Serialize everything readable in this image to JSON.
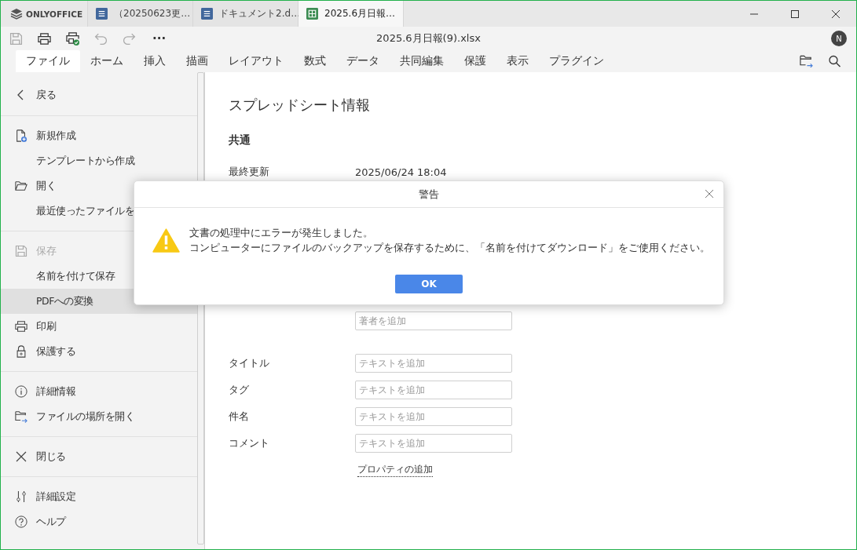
{
  "app": {
    "name": "ONLYOFFICE"
  },
  "tabs": [
    {
      "label": "（20250623更…",
      "kind": "document",
      "selected": false
    },
    {
      "label": "ドキュメント2.d…",
      "kind": "document",
      "selected": false
    },
    {
      "label": "2025.6月日報…",
      "kind": "spreadsheet",
      "selected": true
    }
  ],
  "toolbar": {
    "title": "2025.6月日報(9).xlsx",
    "avatar": "N",
    "more": "···"
  },
  "menu": [
    {
      "label": "ファイル",
      "selected": true
    },
    {
      "label": "ホーム",
      "selected": false
    },
    {
      "label": "挿入",
      "selected": false
    },
    {
      "label": "描画",
      "selected": false
    },
    {
      "label": "レイアウト",
      "selected": false
    },
    {
      "label": "数式",
      "selected": false
    },
    {
      "label": "データ",
      "selected": false
    },
    {
      "label": "共同編集",
      "selected": false
    },
    {
      "label": "保護",
      "selected": false
    },
    {
      "label": "表示",
      "selected": false
    },
    {
      "label": "プラグイン",
      "selected": false
    }
  ],
  "sidebar": {
    "groups": [
      [
        {
          "label": "戻る",
          "kind": "back",
          "selected": false,
          "disabled": false
        }
      ],
      [
        {
          "label": "新規作成",
          "kind": "new",
          "selected": false,
          "disabled": false
        },
        {
          "label": "テンプレートから作成",
          "kind": "plain",
          "selected": false,
          "disabled": false
        },
        {
          "label": "開く",
          "kind": "open",
          "selected": false,
          "disabled": false
        },
        {
          "label": "最近使ったファイルを",
          "kind": "plain",
          "selected": false,
          "disabled": false
        }
      ],
      [
        {
          "label": "保存",
          "kind": "save",
          "selected": false,
          "disabled": true
        },
        {
          "label": "名前を付けて保存",
          "kind": "plain",
          "selected": false,
          "disabled": false
        },
        {
          "label": "PDFへの変換",
          "kind": "plain",
          "selected": true,
          "disabled": false
        },
        {
          "label": "印刷",
          "kind": "print",
          "selected": false,
          "disabled": false
        },
        {
          "label": "保護する",
          "kind": "lock",
          "selected": false,
          "disabled": false
        }
      ],
      [
        {
          "label": "詳細情報",
          "kind": "info",
          "selected": false,
          "disabled": false
        },
        {
          "label": "ファイルの場所を開く",
          "kind": "location",
          "selected": false,
          "disabled": false
        }
      ],
      [
        {
          "label": "閉じる",
          "kind": "close",
          "selected": false,
          "disabled": false
        }
      ],
      [
        {
          "label": "詳細設定",
          "kind": "settings",
          "selected": false,
          "disabled": false
        },
        {
          "label": "ヘルプ",
          "kind": "help",
          "selected": false,
          "disabled": false
        }
      ]
    ]
  },
  "info": {
    "title": "スプレッドシート情報",
    "section": "共通",
    "last_modified": {
      "label": "最終更新",
      "value": "2025/06/24 18:04"
    },
    "author_field": {
      "placeholder": "著者を追加"
    },
    "properties": [
      {
        "label": "タイトル",
        "placeholder": "テキストを追加"
      },
      {
        "label": "タグ",
        "placeholder": "テキストを追加"
      },
      {
        "label": "件名",
        "placeholder": "テキストを追加"
      },
      {
        "label": "コメント",
        "placeholder": "テキストを追加"
      }
    ],
    "add_property": "プロパティの追加"
  },
  "dialog": {
    "title": "警告",
    "lines": [
      "文書の処理中にエラーが発生しました。",
      "コンピューターにファイルのバックアップを保存するために、「名前を付けてダウンロード」をご使用ください。"
    ],
    "button": "OK"
  }
}
